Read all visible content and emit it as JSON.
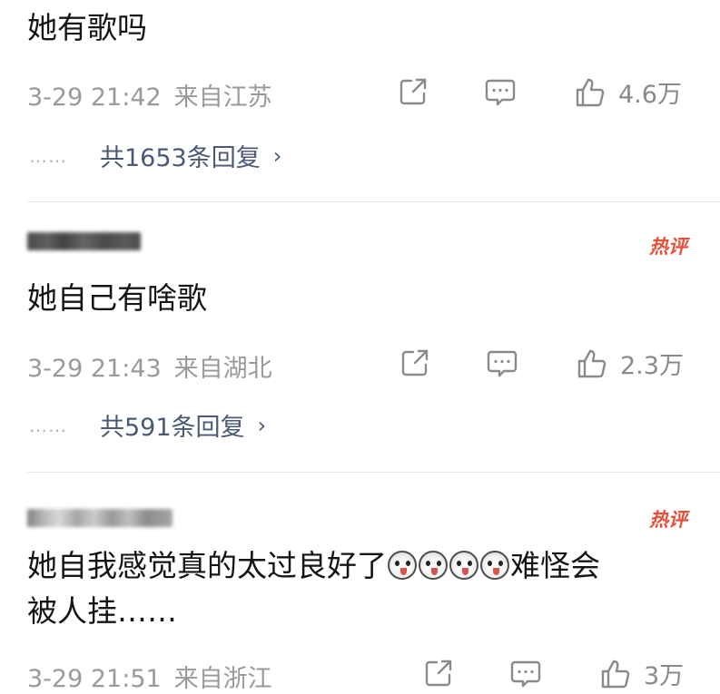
{
  "comments": [
    {
      "text": "她有歌吗",
      "date": "3-29 21:42",
      "location": "来自江苏",
      "likes": "4.6万",
      "replies": "共1653条回复",
      "dots": "……"
    },
    {
      "hot_badge": "热评",
      "text": "她自己有啥歌",
      "date": "3-29 21:43",
      "location": "来自湖北",
      "likes": "2.3万",
      "replies": "共591条回复",
      "dots": "……"
    },
    {
      "hot_badge": "热评",
      "text_line1": "她自我感觉真的太过良好了",
      "text_line1_after": "难怪会",
      "text_line2": "被人挂……",
      "date": "3-29 21:51",
      "location": "来自浙江",
      "likes": "3万"
    }
  ],
  "icons": {
    "share": "share-icon",
    "comment": "comment-icon",
    "like": "thumbs-up-icon",
    "emoji": "husky-emoji-icon"
  },
  "colors": {
    "hot_badge": "#e8503a",
    "reply_link": "#4a5a75",
    "meta": "#9a9a9a"
  }
}
